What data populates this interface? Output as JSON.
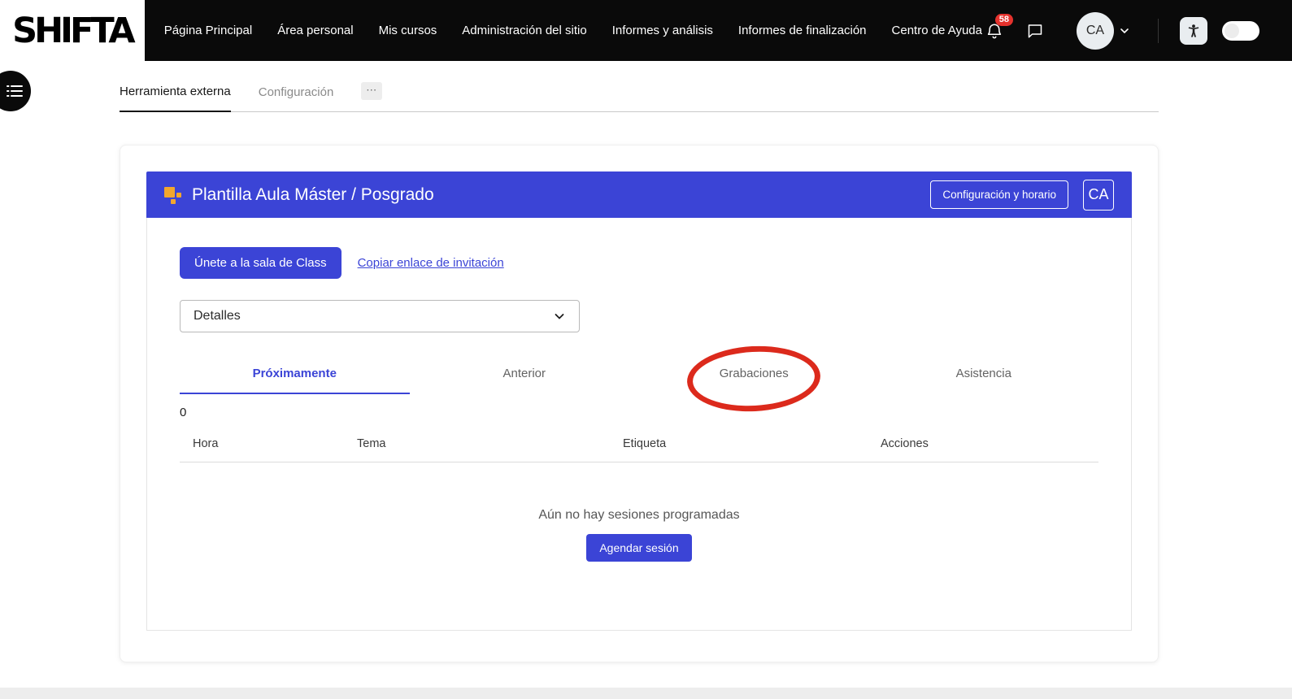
{
  "colors": {
    "primary": "#3b44d6",
    "topbar_bg": "#0a0a0a",
    "badge_red": "#e5322d",
    "annotation_red": "#dc2a1c",
    "header_icon_orange": "#f2a72e"
  },
  "topbar": {
    "logo": "SHIFTA",
    "nav": [
      "Página Principal",
      "Área personal",
      "Mis cursos",
      "Administración del sitio",
      "Informes y análisis",
      "Informes de finalización",
      "Centro de Ayuda"
    ],
    "notification_count": "58",
    "avatar_initials": "CA"
  },
  "page_tabs": {
    "tab_external_tool": "Herramienta externa",
    "tab_settings": "Configuración",
    "more": "⋯"
  },
  "course_card": {
    "title": "Plantilla Aula Máster / Posgrado",
    "config_button": "Configuración y horario",
    "header_badge": "CA",
    "join_button": "Únete a la sala de Class",
    "copy_link": "Copiar enlace de invitación",
    "details_label": "Detalles",
    "tabs": [
      "Próximamente",
      "Anterior",
      "Grabaciones",
      "Asistencia"
    ],
    "sessions_count": "0",
    "table_headers": [
      "Hora",
      "Tema",
      "Etiqueta",
      "Acciones"
    ],
    "empty_message": "Aún no hay sesiones programadas",
    "schedule_button": "Agendar sesión"
  }
}
